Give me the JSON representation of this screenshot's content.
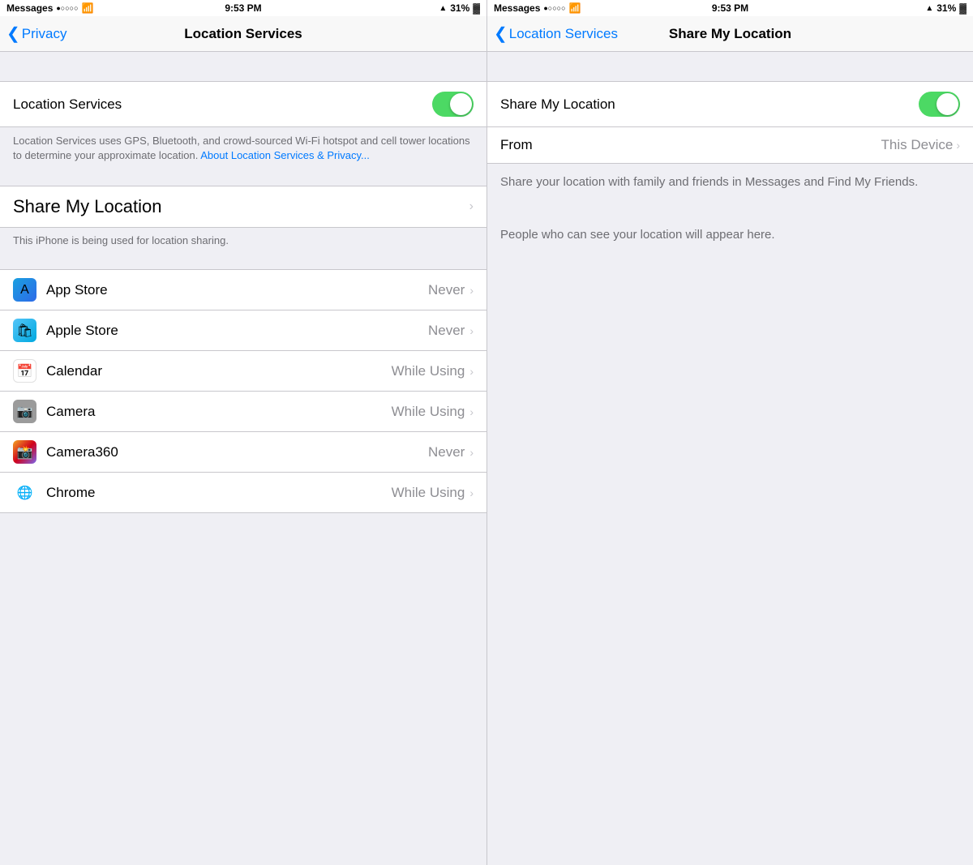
{
  "left": {
    "statusBar": {
      "carrier": "Messages",
      "signal": "●○○○○",
      "wifi": "WiFi",
      "time": "9:53 PM",
      "lock": "🔒",
      "location": "▲",
      "battery": "31%"
    },
    "navBar": {
      "backLabel": "Privacy",
      "title": "Location Services"
    },
    "locationServicesToggle": {
      "label": "Location Services",
      "on": true
    },
    "description": "Location Services uses GPS, Bluetooth, and crowd-sourced Wi-Fi hotspot and cell tower locations to determine your approximate location.",
    "descriptionLink": "About Location Services & Privacy...",
    "shareMyLocation": {
      "label": "Share My Location",
      "chevron": "›"
    },
    "sharingNote": "This iPhone is being used for location sharing.",
    "apps": [
      {
        "name": "App Store",
        "value": "Never",
        "iconClass": "icon-appstore",
        "iconText": "A"
      },
      {
        "name": "Apple Store",
        "value": "Never",
        "iconClass": "icon-applestore",
        "iconText": "🛍"
      },
      {
        "name": "Calendar",
        "value": "While Using",
        "iconClass": "icon-calendar",
        "iconText": "📅"
      },
      {
        "name": "Camera",
        "value": "While Using",
        "iconClass": "icon-camera",
        "iconText": "📷"
      },
      {
        "name": "Camera360",
        "value": "Never",
        "iconClass": "icon-camera360",
        "iconText": "📸"
      },
      {
        "name": "Chrome",
        "value": "While Using",
        "iconClass": "icon-chrome",
        "iconText": "🌐"
      }
    ]
  },
  "right": {
    "statusBar": {
      "carrier": "Messages",
      "signal": "●○○○○",
      "wifi": "WiFi",
      "time": "9:53 PM",
      "lock": "🔒",
      "location": "▲",
      "battery": "31%"
    },
    "navBar": {
      "backLabel": "Location Services",
      "title": "Share My Location"
    },
    "shareMyLocationToggle": {
      "label": "Share My Location",
      "on": true
    },
    "fromRow": {
      "label": "From",
      "value": "This Device",
      "chevron": "›"
    },
    "infoLine1": "Share your location with family and friends in Messages and Find My Friends.",
    "infoLine2": "People who can see your location will appear here."
  }
}
